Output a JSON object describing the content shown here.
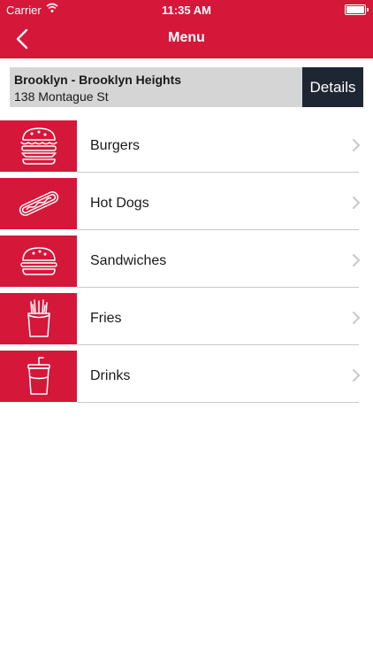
{
  "status": {
    "carrier": "Carrier",
    "time": "11:35 AM"
  },
  "nav": {
    "title": "Menu",
    "back_icon": "chevron-left-icon"
  },
  "location": {
    "name": "Brooklyn - Brooklyn Heights",
    "address": "138 Montague St",
    "details_label": "Details"
  },
  "menu": {
    "items": [
      {
        "label": "Burgers",
        "icon": "burger-icon"
      },
      {
        "label": "Hot Dogs",
        "icon": "hotdog-icon"
      },
      {
        "label": "Sandwiches",
        "icon": "sandwich-icon"
      },
      {
        "label": "Fries",
        "icon": "fries-icon"
      },
      {
        "label": "Drinks",
        "icon": "drink-icon"
      }
    ]
  },
  "colors": {
    "accent": "#d5173a",
    "dark": "#1e2633",
    "bar": "#d5d5d5"
  }
}
